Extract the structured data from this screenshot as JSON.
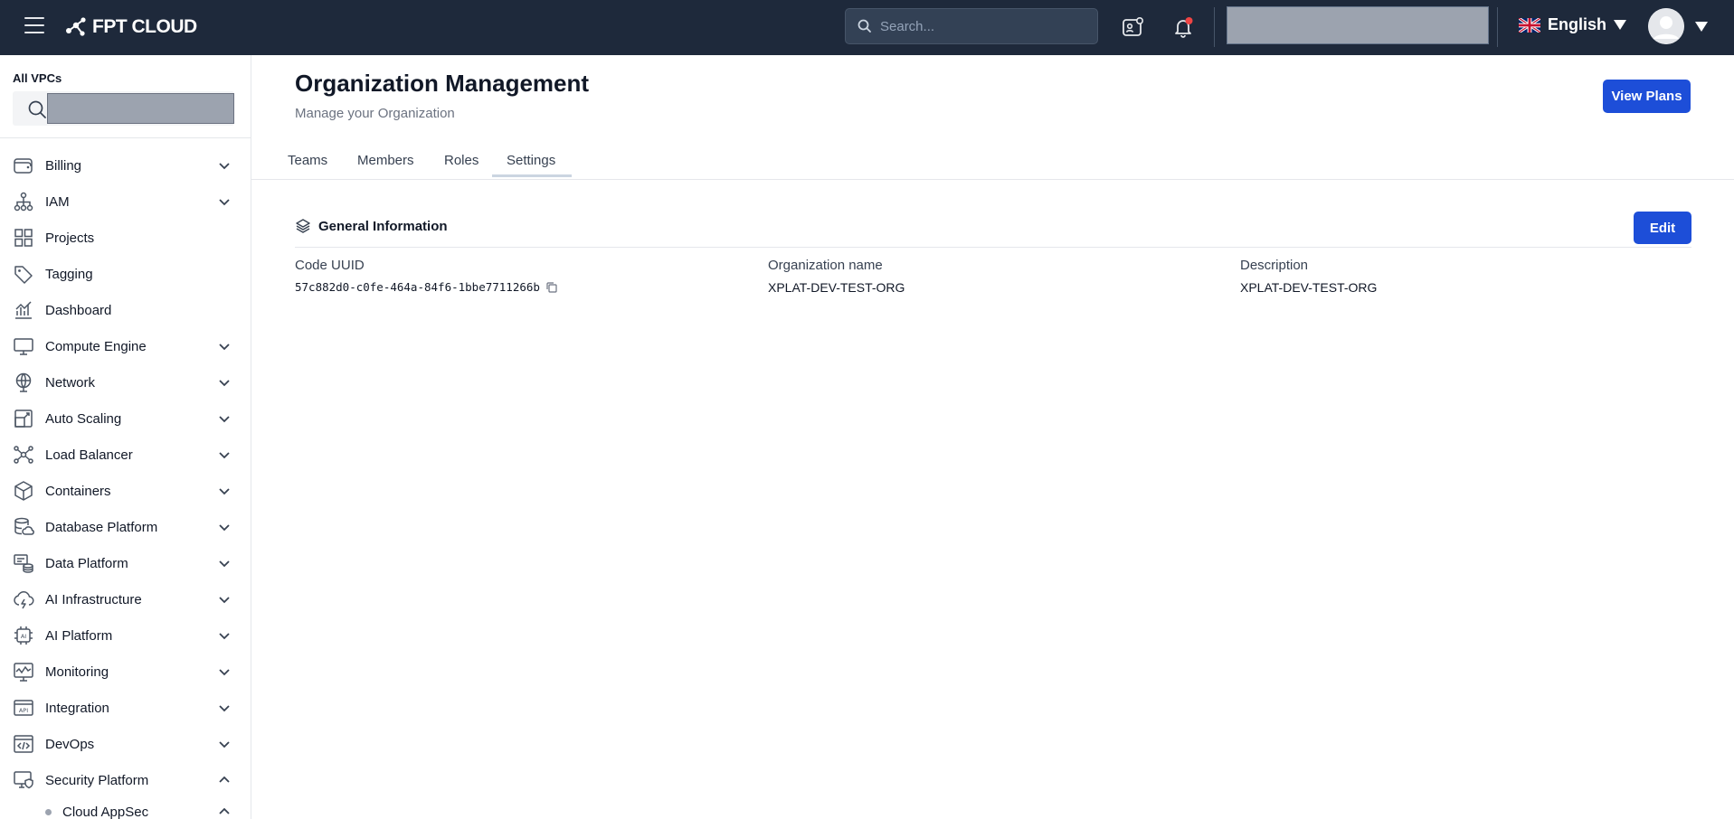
{
  "header": {
    "brand": "FPT CLOUD",
    "search_placeholder": "Search...",
    "language": "English"
  },
  "sidebar": {
    "vpc_label": "All VPCs",
    "items": [
      {
        "label": "Billing",
        "icon": "wallet-icon",
        "expandable": true,
        "expanded": false
      },
      {
        "label": "IAM",
        "icon": "org-chart-icon",
        "expandable": true,
        "expanded": false
      },
      {
        "label": "Projects",
        "icon": "grid-icon",
        "expandable": false
      },
      {
        "label": "Tagging",
        "icon": "tag-icon",
        "expandable": false
      },
      {
        "label": "Dashboard",
        "icon": "chart-icon",
        "expandable": false
      },
      {
        "label": "Compute Engine",
        "icon": "monitor-icon",
        "expandable": true,
        "expanded": false
      },
      {
        "label": "Network",
        "icon": "globe-icon",
        "expandable": true,
        "expanded": false
      },
      {
        "label": "Auto Scaling",
        "icon": "scaling-icon",
        "expandable": true,
        "expanded": false
      },
      {
        "label": "Load Balancer",
        "icon": "network-nodes-icon",
        "expandable": true,
        "expanded": false
      },
      {
        "label": "Containers",
        "icon": "box-icon",
        "expandable": true,
        "expanded": false
      },
      {
        "label": "Database Platform",
        "icon": "database-icon",
        "expandable": true,
        "expanded": false
      },
      {
        "label": "Data Platform",
        "icon": "data-stack-icon",
        "expandable": true,
        "expanded": false
      },
      {
        "label": "AI Infrastructure",
        "icon": "cloud-lightning-icon",
        "expandable": true,
        "expanded": false
      },
      {
        "label": "AI Platform",
        "icon": "ai-chip-icon",
        "expandable": true,
        "expanded": false
      },
      {
        "label": "Monitoring",
        "icon": "monitoring-icon",
        "expandable": true,
        "expanded": false
      },
      {
        "label": "Integration",
        "icon": "api-icon",
        "expandable": true,
        "expanded": false
      },
      {
        "label": "DevOps",
        "icon": "code-window-icon",
        "expandable": true,
        "expanded": false
      },
      {
        "label": "Security Platform",
        "icon": "shield-monitor-icon",
        "expandable": true,
        "expanded": true
      }
    ],
    "sub_items": [
      {
        "label": "Cloud AppSec",
        "expanded": true
      }
    ]
  },
  "page": {
    "title": "Organization Management",
    "subtitle": "Manage your Organization",
    "view_plans_label": "View Plans",
    "tabs": [
      {
        "label": "Teams",
        "active": false
      },
      {
        "label": "Members",
        "active": false
      },
      {
        "label": "Roles",
        "active": false
      },
      {
        "label": "Settings",
        "active": true
      }
    ]
  },
  "general_info": {
    "title": "General Information",
    "edit_label": "Edit",
    "fields": {
      "code_uuid": {
        "label": "Code UUID",
        "value": "57c882d0-c0fe-464a-84f6-1bbe7711266b"
      },
      "org_name": {
        "label": "Organization name",
        "value": "XPLAT-DEV-TEST-ORG"
      },
      "description": {
        "label": "Description",
        "value": "XPLAT-DEV-TEST-ORG"
      }
    }
  },
  "colors": {
    "topbar_bg": "#1e293b",
    "primary": "#1d4ed8",
    "notification_dot": "#ef4444"
  }
}
